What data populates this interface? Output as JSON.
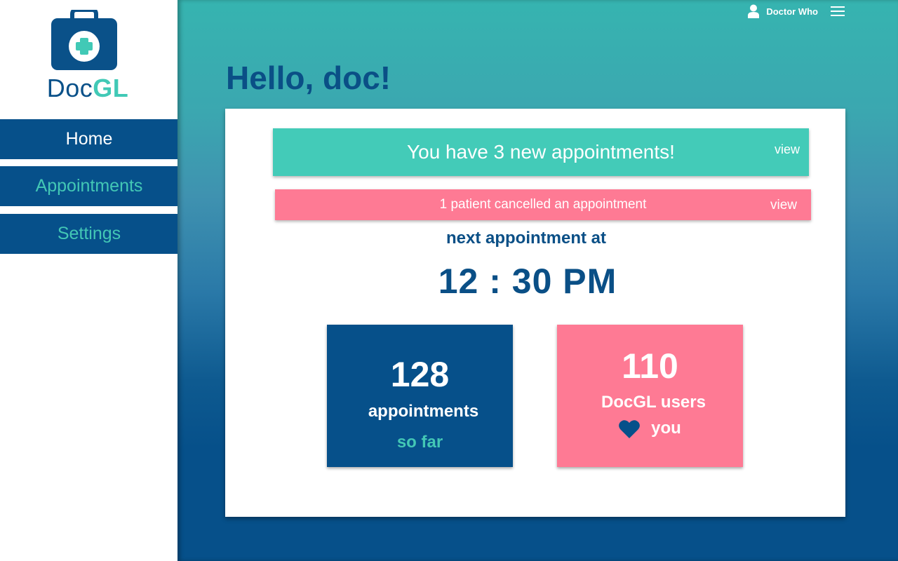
{
  "app": {
    "logo_text_main": "Doc",
    "logo_text_accent": "GL"
  },
  "sidebar": {
    "items": [
      {
        "label": "Home"
      },
      {
        "label": "Appointments"
      },
      {
        "label": "Settings"
      }
    ]
  },
  "header": {
    "user_name": "Doctor Who",
    "user_icon": "user-icon",
    "menu_icon": "hamburger-menu-icon"
  },
  "main": {
    "greeting": "Hello, doc!",
    "banners": {
      "new_appointments": {
        "message": "You have 3 new appointments!",
        "action": "view"
      },
      "cancelled": {
        "message": "1 patient cancelled an appointment",
        "action": "view"
      }
    },
    "next_appointment": {
      "label": "next appointment at",
      "time": "12 : 30 PM"
    },
    "stats": {
      "appointments": {
        "number": "128",
        "label": "appointments",
        "sub": "so far"
      },
      "users": {
        "number": "110",
        "label": "DocGL users",
        "sub": "you",
        "icon": "heart-icon"
      }
    }
  },
  "colors": {
    "navy": "#06508a",
    "teal": "#43cbb8",
    "pink": "#fe7a94",
    "white": "#ffffff"
  }
}
